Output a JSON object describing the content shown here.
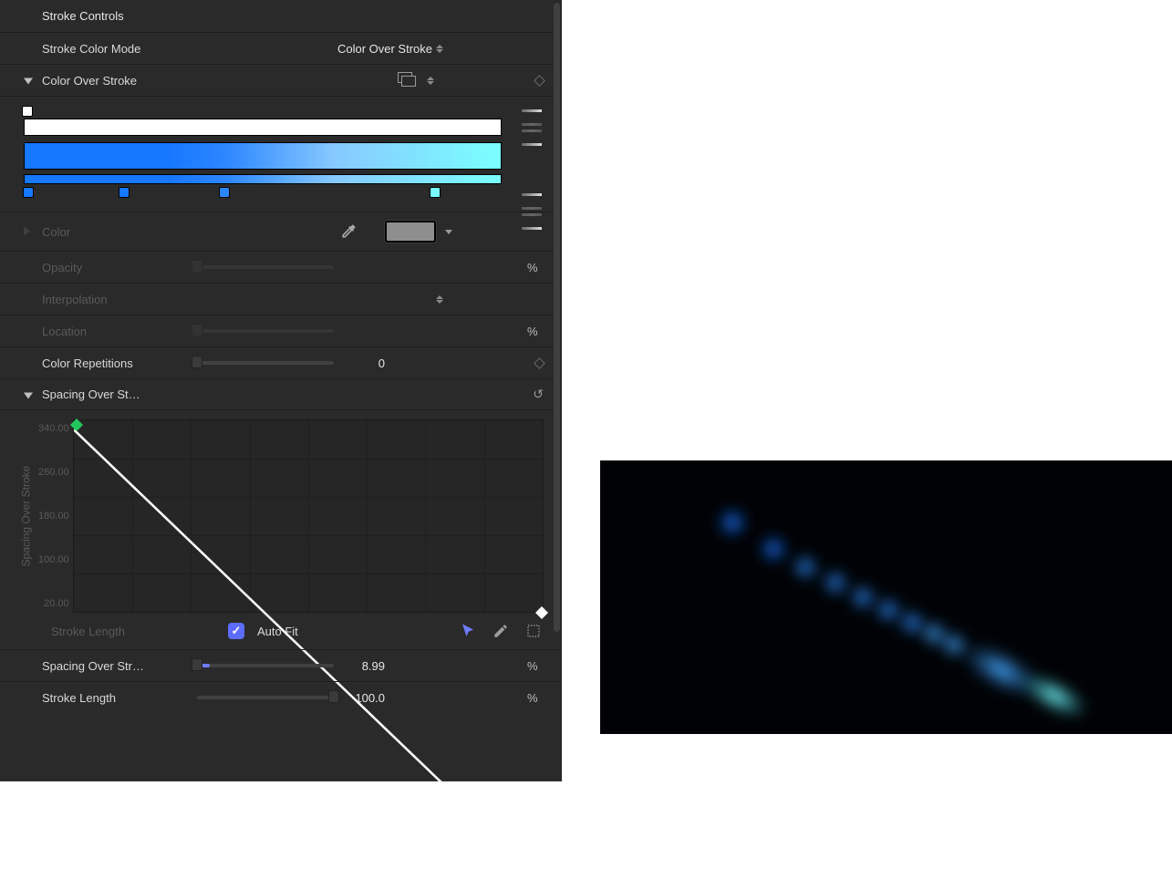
{
  "panel": {
    "title": "Stroke Controls",
    "stroke_color_mode": {
      "label": "Stroke Color Mode",
      "value": "Color Over Stroke"
    },
    "color_over_stroke": {
      "label": "Color Over Stroke"
    },
    "gradient": {
      "stops": [
        {
          "position": 0,
          "color": "#1677ff"
        },
        {
          "position": 21,
          "color": "#1677ff"
        },
        {
          "position": 42,
          "color": "#2c86ff"
        },
        {
          "position": 86,
          "color": "#7affff"
        }
      ]
    },
    "color": {
      "label": "Color",
      "swatch": "#8e8e8e"
    },
    "opacity": {
      "label": "Opacity",
      "unit": "%"
    },
    "interpolation": {
      "label": "Interpolation"
    },
    "location": {
      "label": "Location",
      "unit": "%"
    },
    "color_reps": {
      "label": "Color Repetitions",
      "value": "0"
    },
    "spacing_over": {
      "label": "Spacing Over St…",
      "y_axis_label": "Spacing Over Stroke",
      "y_ticks": [
        "340.00",
        "260.00",
        "180.00",
        "100.00",
        "20.00"
      ],
      "x_axis_label": "Stroke Length",
      "auto_fit": "Auto Fit"
    },
    "spacing_over_stroke_value": {
      "label": "Spacing Over Str…",
      "value": "8.99",
      "unit": "%"
    },
    "stroke_length_value": {
      "label": "Stroke Length",
      "value": "100.0",
      "unit": "%"
    }
  }
}
